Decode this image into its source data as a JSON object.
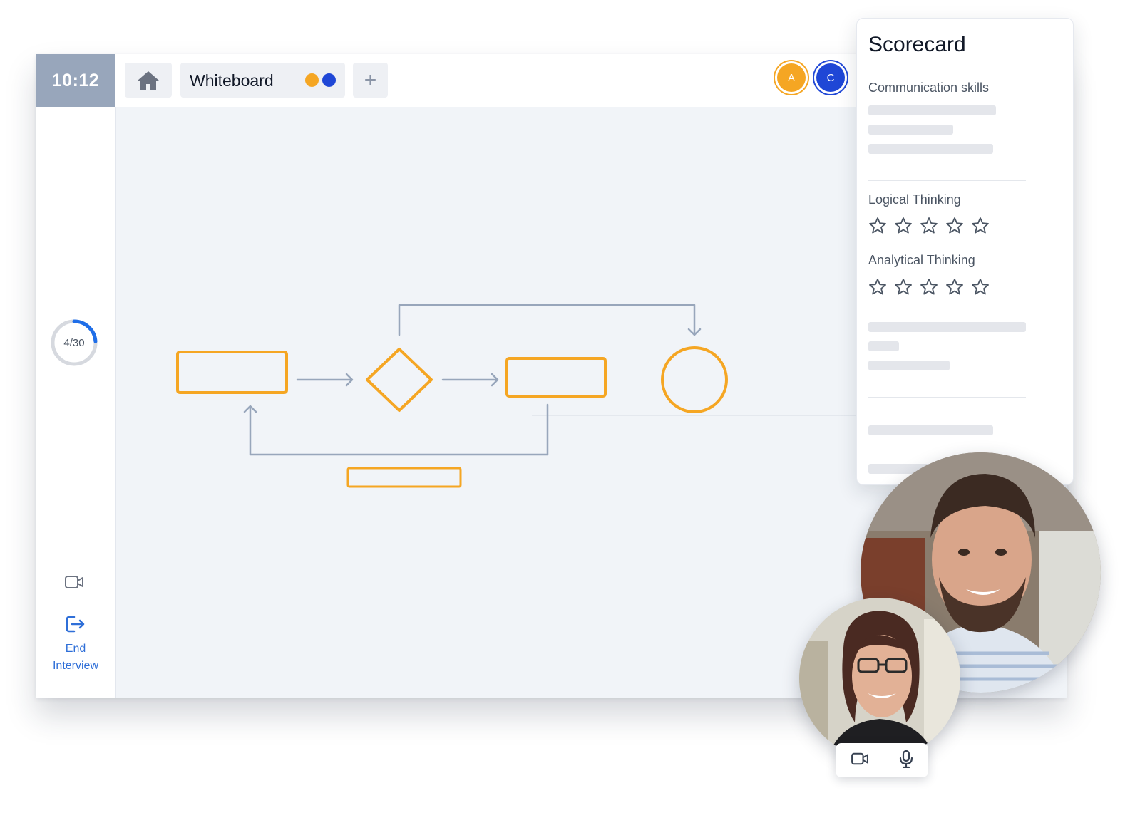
{
  "timer": "10:12",
  "tabs": {
    "active_label": "Whiteboard",
    "add_label": "+",
    "presence_colors": [
      "#f5a623",
      "#1f47d6"
    ]
  },
  "participants": [
    {
      "initial": "A",
      "color": "#f5a623"
    },
    {
      "initial": "C",
      "color": "#1f47d6"
    }
  ],
  "sidebar": {
    "progress_text": "4/30",
    "progress_fraction": 0.1333,
    "end_button_line1": "End",
    "end_button_line2": "Interview"
  },
  "scorecard": {
    "title": "Scorecard",
    "sections": [
      {
        "label": "Communication skills"
      },
      {
        "label": "Logical Thinking",
        "rating": 0,
        "max": 5
      },
      {
        "label": "Analytical Thinking",
        "rating": 0,
        "max": 5
      }
    ]
  },
  "icons": {
    "home": "home-icon",
    "camera": "video-camera-icon",
    "exit": "exit-icon",
    "mic": "microphone-icon",
    "star": "star-outline-icon"
  },
  "colors": {
    "accent_orange": "#f5a623",
    "accent_blue": "#1f47d6",
    "connector": "#98a6bb",
    "timer_bg": "#98a6bb"
  }
}
